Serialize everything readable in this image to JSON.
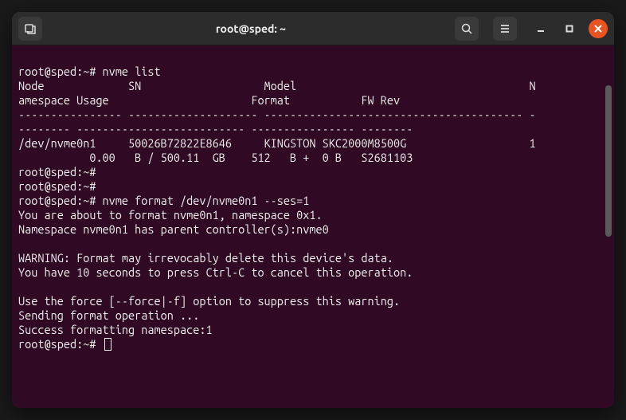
{
  "titlebar": {
    "title": "root@sped: ~"
  },
  "terminal": {
    "lines": [
      "root@sped:~# nvme list",
      "Node             SN                   Model                                    N",
      "amespace Usage                      Format           FW Rev  ",
      "---------------- -------------------- ---------------------------------------- -",
      "-------- -------------------------- ---------------- --------",
      "/dev/nvme0n1     50026B72822E8646     KINGSTON SKC2000M8500G                   1",
      "           0.00   B / 500.11  GB    512   B +  0 B   S2681103",
      "root@sped:~# ",
      "root@sped:~# ",
      "root@sped:~# nvme format /dev/nvme0n1 --ses=1",
      "You are about to format nvme0n1, namespace 0x1.",
      "Namespace nvme0n1 has parent controller(s):nvme0",
      "",
      "WARNING: Format may irrevocably delete this device's data.",
      "You have 10 seconds to press Ctrl-C to cancel this operation.",
      "",
      "Use the force [--force|-f] option to suppress this warning.",
      "Sending format operation ...",
      "Success formatting namespace:1",
      "root@sped:~# "
    ]
  }
}
